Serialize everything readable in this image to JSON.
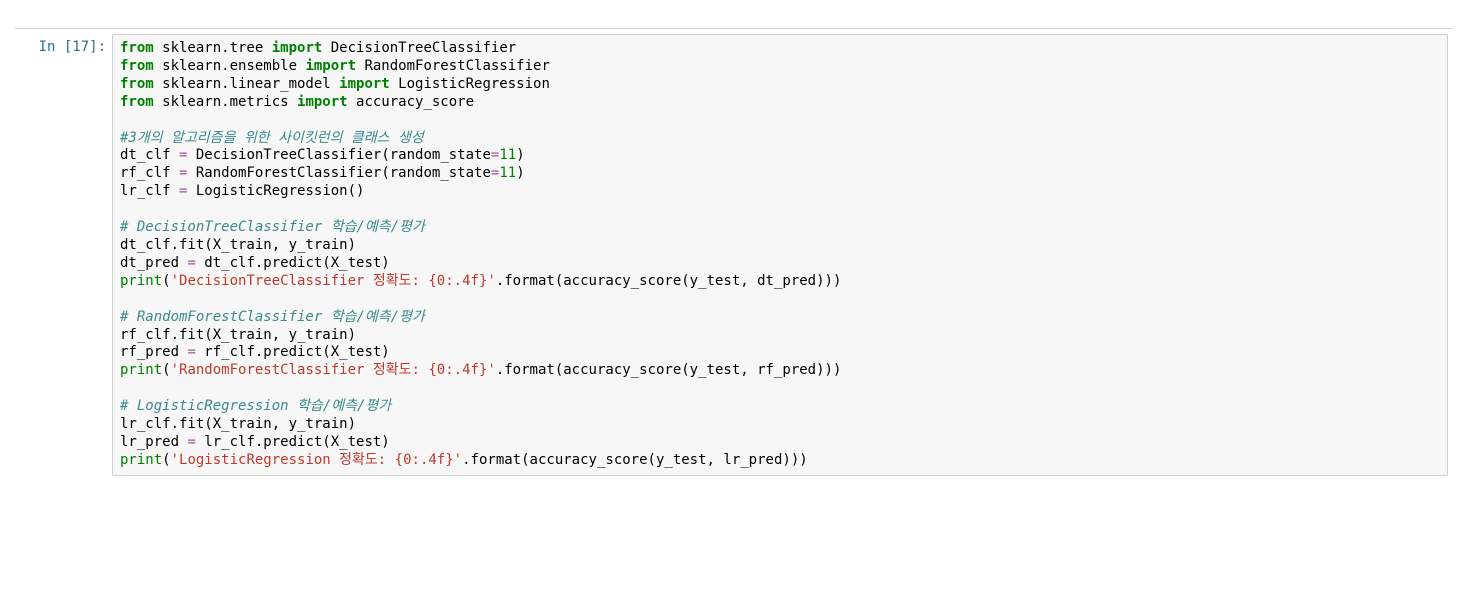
{
  "cell": {
    "prompt": "In [17]:",
    "code": {
      "l01_from": "from",
      "l01_m": " sklearn.tree ",
      "l01_import": "import",
      "l01_n": " DecisionTreeClassifier",
      "l02_from": "from",
      "l02_m": " sklearn.ensemble ",
      "l02_import": "import",
      "l02_n": " RandomForestClassifier",
      "l03_from": "from",
      "l03_m": " sklearn.linear_model ",
      "l03_import": "import",
      "l03_n": " LogisticRegression",
      "l04_from": "from",
      "l04_m": " sklearn.metrics ",
      "l04_import": "import",
      "l04_n": " accuracy_score",
      "blank": "",
      "l06_cmt": "#3개의 알고리즘을 위한 사이킷런의 클래스 생성",
      "l07a": "dt_clf ",
      "l07eq": "=",
      "l07b": " DecisionTreeClassifier(random_state",
      "l07eq2": "=",
      "l07num": "11",
      "l07c": ")",
      "l08a": "rf_clf ",
      "l08eq": "=",
      "l08b": " RandomForestClassifier(random_state",
      "l08eq2": "=",
      "l08num": "11",
      "l08c": ")",
      "l09a": "lr_clf ",
      "l09eq": "=",
      "l09b": " LogisticRegression()",
      "l11_cmt": "# DecisionTreeClassifier 학습/예측/평가",
      "l12": "dt_clf.fit(X_train, y_train)",
      "l13a": "dt_pred ",
      "l13eq": "=",
      "l13b": " dt_clf.predict(X_test)",
      "l14_print": "print",
      "l14a": "(",
      "l14_str": "'DecisionTreeClassifier 정확도: {0:.4f}'",
      "l14b": ".format(accuracy_score(y_test, dt_pred)))",
      "l16_cmt": "# RandomForestClassifier 학습/예측/평가",
      "l17": "rf_clf.fit(X_train, y_train)",
      "l18a": "rf_pred ",
      "l18eq": "=",
      "l18b": " rf_clf.predict(X_test)",
      "l19_print": "print",
      "l19a": "(",
      "l19_str": "'RandomForestClassifier 정확도: {0:.4f}'",
      "l19b": ".format(accuracy_score(y_test, rf_pred)))",
      "l21_cmt": "# LogisticRegression 학습/예측/평가",
      "l22": "lr_clf.fit(X_train, y_train)",
      "l23a": "lr_pred ",
      "l23eq": "=",
      "l23b": " lr_clf.predict(X_test)",
      "l24_print": "print",
      "l24a": "(",
      "l24_str": "'LogisticRegression 정확도: {0:.4f}'",
      "l24b": ".format(accuracy_score(y_test, lr_pred)))"
    }
  }
}
